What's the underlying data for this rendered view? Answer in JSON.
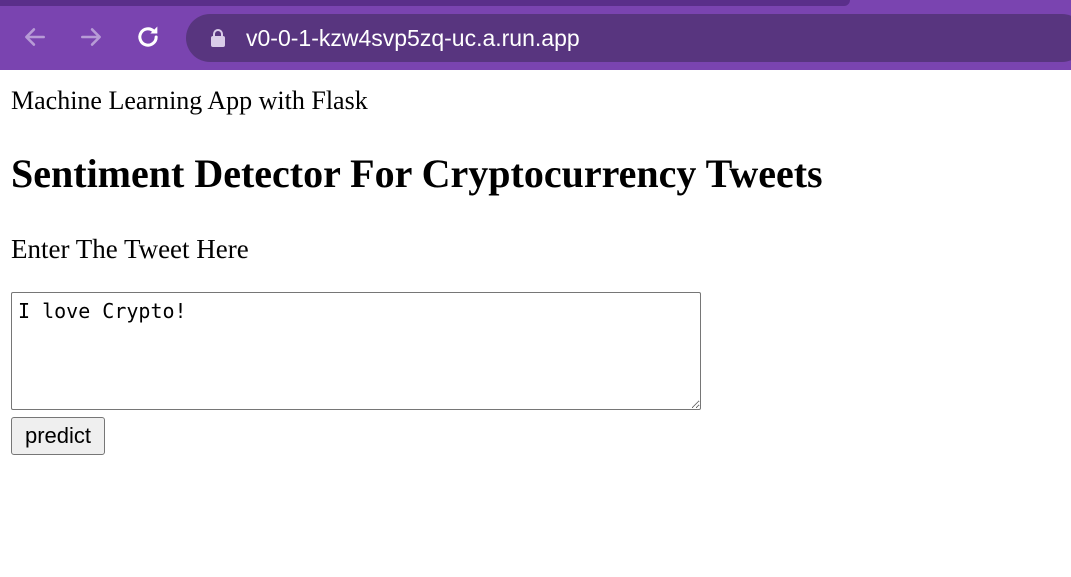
{
  "browser": {
    "url": "v0-0-1-kzw4svp5zq-uc.a.run.app",
    "icons": [
      "back-arrow-icon",
      "forward-arrow-icon",
      "reload-icon",
      "lock-icon"
    ],
    "colors": {
      "toolbar": "#7a44b0",
      "omnibox": "#58357f",
      "text": "#ffffff"
    }
  },
  "page": {
    "subtitle": "Machine Learning App with Flask",
    "heading": "Sentiment Detector For Cryptocurrency Tweets",
    "prompt_label": "Enter The Tweet Here",
    "tweet_value": "I love Crypto!",
    "predict_label": "predict"
  }
}
